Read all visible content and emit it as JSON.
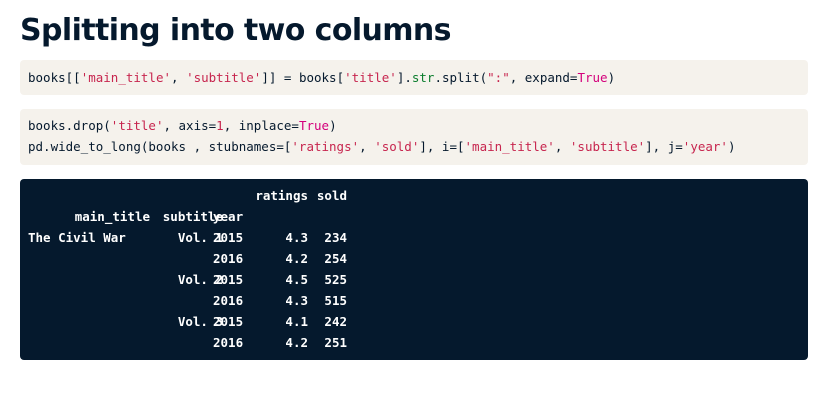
{
  "heading": "Splitting into two columns",
  "code1": {
    "lines": [
      [
        {
          "t": "books[[",
          "c": ""
        },
        {
          "t": "'main_title'",
          "c": "s"
        },
        {
          "t": ", ",
          "c": ""
        },
        {
          "t": "'subtitle'",
          "c": "s"
        },
        {
          "t": "]] = books[",
          "c": ""
        },
        {
          "t": "'title'",
          "c": "s"
        },
        {
          "t": "].",
          "c": ""
        },
        {
          "t": "str",
          "c": "f"
        },
        {
          "t": ".split(",
          "c": ""
        },
        {
          "t": "\":\"",
          "c": "s"
        },
        {
          "t": ", expand=",
          "c": ""
        },
        {
          "t": "True",
          "c": "k"
        },
        {
          "t": ")",
          "c": ""
        }
      ]
    ]
  },
  "code2": {
    "lines": [
      [
        {
          "t": "books.drop(",
          "c": ""
        },
        {
          "t": "'title'",
          "c": "s"
        },
        {
          "t": ", axis=",
          "c": ""
        },
        {
          "t": "1",
          "c": "n"
        },
        {
          "t": ", inplace=",
          "c": ""
        },
        {
          "t": "True",
          "c": "k"
        },
        {
          "t": ")",
          "c": ""
        }
      ],
      [
        {
          "t": "pd.wide_to_long(books , stubnames=[",
          "c": ""
        },
        {
          "t": "'ratings'",
          "c": "s"
        },
        {
          "t": ", ",
          "c": ""
        },
        {
          "t": "'sold'",
          "c": "s"
        },
        {
          "t": "], i=[",
          "c": ""
        },
        {
          "t": "'main_title'",
          "c": "s"
        },
        {
          "t": ", ",
          "c": ""
        },
        {
          "t": "'subtitle'",
          "c": "s"
        },
        {
          "t": "], j=",
          "c": ""
        },
        {
          "t": "'year'",
          "c": "s"
        },
        {
          "t": ")",
          "c": ""
        }
      ]
    ]
  },
  "output": {
    "value_headers": [
      "ratings",
      "sold"
    ],
    "index_headers": [
      "main_title",
      "subtitle",
      "year"
    ],
    "rows": [
      {
        "main_title": "The Civil War",
        "subtitle": "Vol. 1",
        "year": "2015",
        "ratings": "4.3",
        "sold": "234"
      },
      {
        "main_title": "",
        "subtitle": "",
        "year": "2016",
        "ratings": "4.2",
        "sold": "254"
      },
      {
        "main_title": "",
        "subtitle": "Vol. 2",
        "year": "2015",
        "ratings": "4.5",
        "sold": "525"
      },
      {
        "main_title": "",
        "subtitle": "",
        "year": "2016",
        "ratings": "4.3",
        "sold": "515"
      },
      {
        "main_title": "",
        "subtitle": "Vol. 3",
        "year": "2015",
        "ratings": "4.1",
        "sold": "242"
      },
      {
        "main_title": "",
        "subtitle": "",
        "year": "2016",
        "ratings": "4.2",
        "sold": "251"
      }
    ]
  },
  "colors": {
    "heading": "#05192d",
    "code_bg": "#f5f2ec",
    "output_bg": "#05192d",
    "string": "#c7254e",
    "keyword": "#d4007b",
    "method": "#0b7d2d"
  }
}
